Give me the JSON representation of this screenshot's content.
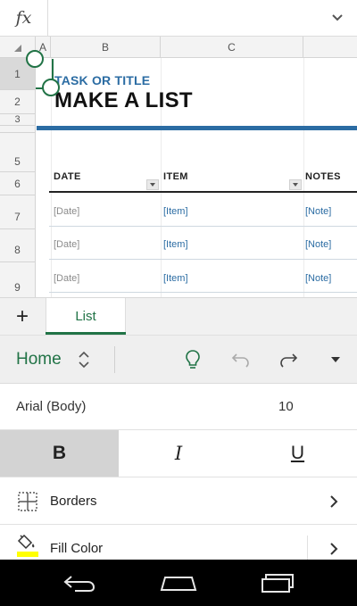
{
  "formula_bar": {
    "fx_label": "fx",
    "value": ""
  },
  "grid": {
    "columns": [
      "A",
      "B",
      "C"
    ],
    "rows": [
      "1",
      "2",
      "3",
      "5",
      "6",
      "7",
      "8",
      "9"
    ],
    "selected_cell": "A1"
  },
  "sheet": {
    "subtitle": "TASK OR TITLE",
    "title": "MAKE A LIST",
    "headers": [
      "DATE",
      "ITEM",
      "NOTES"
    ],
    "rows": [
      {
        "date": "[Date]",
        "item": "[Item]",
        "notes": "[Note]"
      },
      {
        "date": "[Date]",
        "item": "[Item]",
        "notes": "[Note]"
      },
      {
        "date": "[Date]",
        "item": "[Item]",
        "notes": "[Note]"
      }
    ]
  },
  "tabs": {
    "add_label": "+",
    "items": [
      "List"
    ]
  },
  "ribbon": {
    "tab_label": "Home",
    "icons": [
      "lightbulb-icon",
      "undo-icon",
      "redo-icon",
      "more-icon"
    ]
  },
  "font": {
    "name": "Arial (Body)",
    "size": "10"
  },
  "format": {
    "bold": "B",
    "italic": "I",
    "underline": "U"
  },
  "list": {
    "borders_label": "Borders",
    "fill_label": "Fill Color"
  },
  "colors": {
    "accent": "#217346",
    "title_blue": "#2b6ca3"
  }
}
